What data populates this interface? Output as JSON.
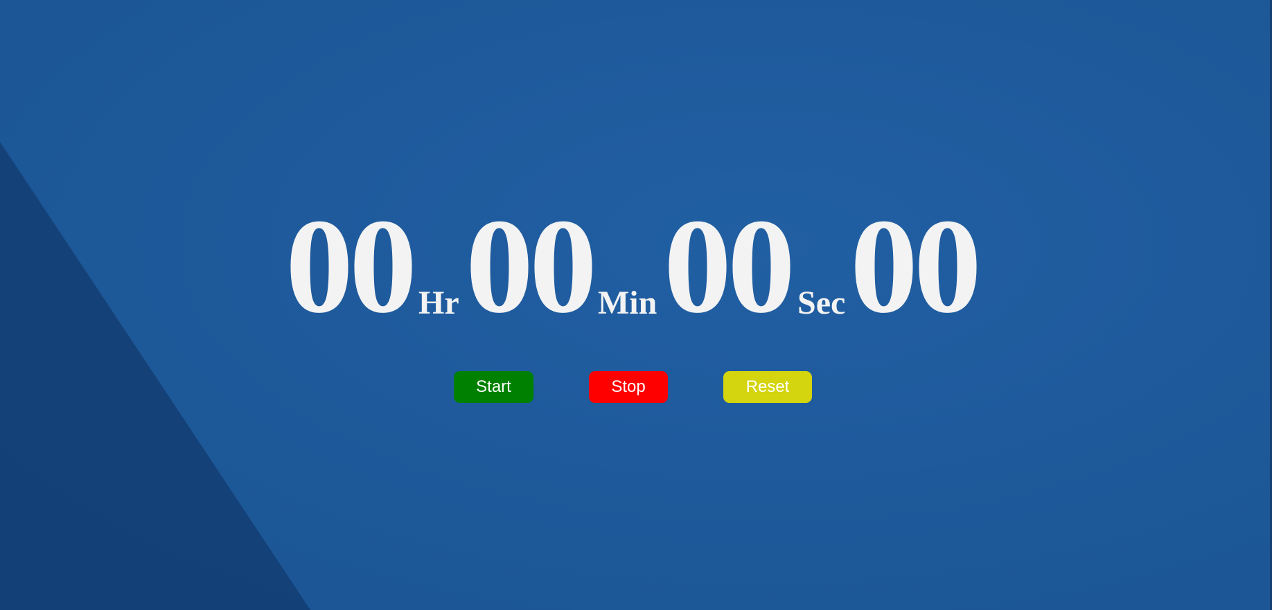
{
  "timer": {
    "hours": "00",
    "hours_unit": "Hr",
    "minutes": "00",
    "minutes_unit": "Min",
    "seconds": "00",
    "seconds_unit": "Sec",
    "centiseconds": "00"
  },
  "controls": {
    "start_label": "Start",
    "stop_label": "Stop",
    "reset_label": "Reset"
  },
  "colors": {
    "background": "#1e5a9e",
    "background_shadow": "#123d72",
    "digit_text": "#f3f3f3",
    "start_button": "#008000",
    "stop_button": "#ff0000",
    "reset_button": "#d4d40f"
  }
}
